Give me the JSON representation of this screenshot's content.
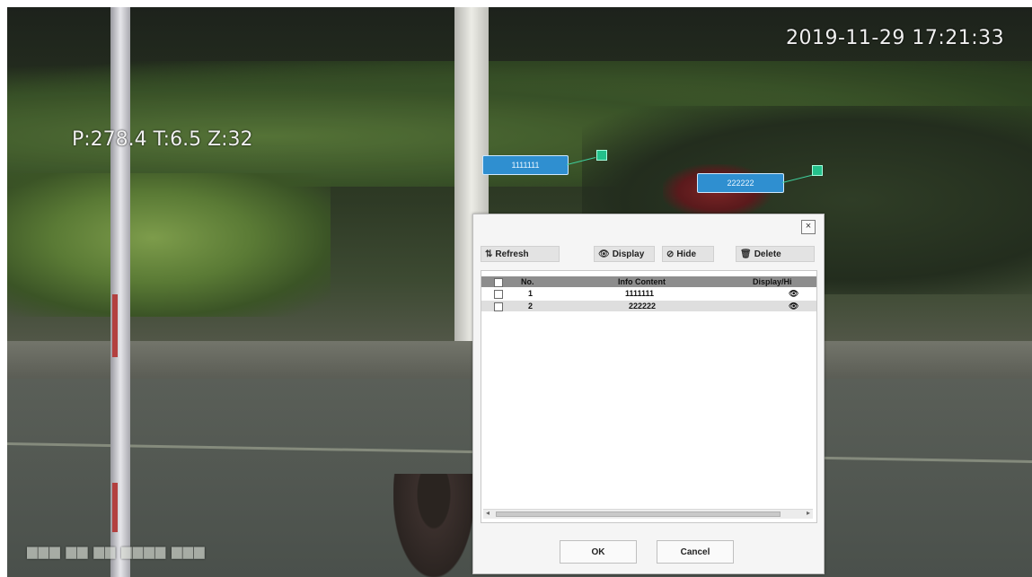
{
  "video": {
    "timestamp": "2019-11-29 17:21:33",
    "ptz": "P:278.4 T:6.5 Z:32",
    "bottom_osd": "▆▆▆ ▆▆ ▆▆ ▆▆▆▆ ▆▆▆"
  },
  "overlay_tags": [
    {
      "text": "1111111"
    },
    {
      "text": "222222"
    }
  ],
  "dialog": {
    "close_glyph": "×",
    "toolbar": {
      "refresh": {
        "icon": "refresh-icon",
        "label": "Refresh"
      },
      "display": {
        "icon": "eye-icon",
        "label": "Display"
      },
      "hide": {
        "icon": "eye-hidden-icon",
        "label": "Hide"
      },
      "delete": {
        "icon": "trash-icon",
        "label": "Delete"
      }
    },
    "columns": [
      "No.",
      "Info Content",
      "Display/Hi"
    ],
    "rows": [
      {
        "no": "1",
        "content": "1111111",
        "status": "👁"
      },
      {
        "no": "2",
        "content": "222222",
        "status": "👁"
      }
    ],
    "ok_label": "OK",
    "cancel_label": "Cancel"
  }
}
